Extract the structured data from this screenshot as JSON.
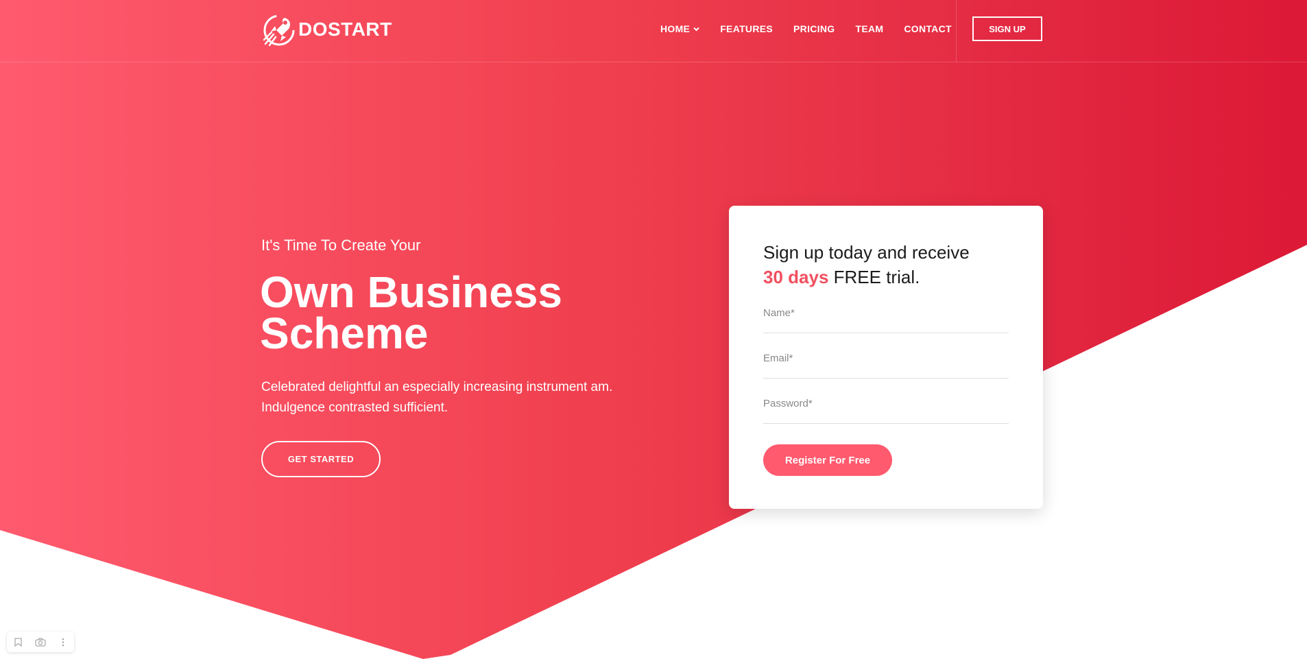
{
  "header": {
    "logo_text": "DOSTART",
    "nav": [
      {
        "label": "HOME",
        "has_dropdown": true
      },
      {
        "label": "FEATURES"
      },
      {
        "label": "PRICING"
      },
      {
        "label": "TEAM"
      },
      {
        "label": "CONTACT"
      }
    ],
    "signup_label": "SIGN UP"
  },
  "hero": {
    "subtitle": "It's Time To Create Your",
    "title": "Own Business Scheme",
    "description": "Celebrated delightful an especially increasing instrument am. Indulgence contrasted sufficient.",
    "cta_label": "GET STARTED"
  },
  "signup_card": {
    "title_prefix": "Sign up today and receive",
    "title_highlight": "30 days",
    "title_suffix": "FREE trial.",
    "name_placeholder": "Name*",
    "email_placeholder": "Email*",
    "password_placeholder": "Password*",
    "register_label": "Register For Free"
  },
  "colors": {
    "accent": "#ff5a6e",
    "gradient_start": "#ff5a6e",
    "gradient_end": "#dc1936"
  },
  "toolbar_icons": [
    "bookmark-icon",
    "camera-icon",
    "more-icon"
  ]
}
